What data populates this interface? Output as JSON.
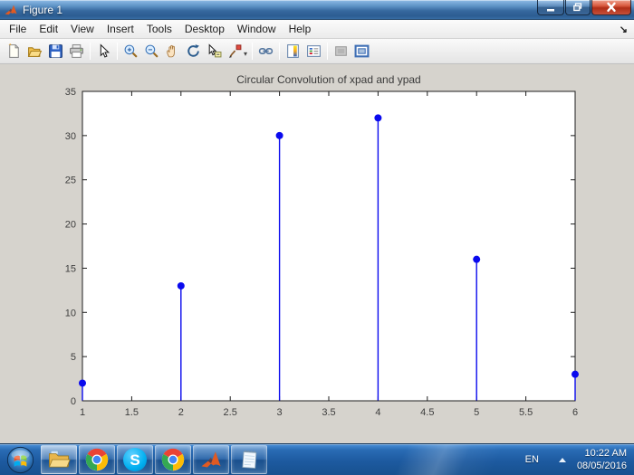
{
  "window": {
    "title": "Figure 1"
  },
  "icons": {
    "dock_arrow": "↘",
    "brush_caret": "▾"
  },
  "menu": {
    "items": [
      "File",
      "Edit",
      "View",
      "Insert",
      "Tools",
      "Desktop",
      "Window",
      "Help"
    ]
  },
  "toolbar": {
    "icons": [
      "new-figure",
      "open-file",
      "save-figure",
      "print-figure",
      "edit-plot",
      "zoom-in",
      "zoom-out",
      "pan",
      "rotate-3d",
      "data-cursor",
      "brush-data",
      "link-plot",
      "insert-colorbar",
      "insert-legend",
      "hide-plot-tools",
      "show-plot-tools-dock"
    ]
  },
  "chart_data": {
    "type": "stem",
    "title": "Circular Convolution of xpad and ypad",
    "x": [
      1,
      2,
      3,
      4,
      5,
      6
    ],
    "y": [
      2,
      13,
      30,
      32,
      16,
      3
    ],
    "xlabel": "",
    "ylabel": "",
    "xlim": [
      1,
      6
    ],
    "ylim": [
      0,
      35
    ],
    "xticks": [
      1,
      1.5,
      2,
      2.5,
      3,
      3.5,
      4,
      4.5,
      5,
      5.5,
      6
    ],
    "yticks": [
      0,
      5,
      10,
      15,
      20,
      25,
      30,
      35
    ],
    "grid": false,
    "legend": null,
    "box": true,
    "stem_color": "#0a0aee",
    "marker": "filled-circle",
    "background": "#ffffff"
  },
  "taskbar": {
    "items": [
      {
        "name": "start"
      },
      {
        "name": "windows-explorer"
      },
      {
        "name": "chrome"
      },
      {
        "name": "skype",
        "glyph": "S"
      },
      {
        "name": "chrome-2"
      },
      {
        "name": "matlab"
      },
      {
        "name": "notepad"
      }
    ],
    "tray": {
      "language": "EN",
      "time": "10:22 AM",
      "date": "08/05/2016"
    }
  },
  "colors": {
    "stem": "#0a0aee",
    "titlebar": "#36689e",
    "taskbar": "#1d5aa0",
    "canvas": "#d6d3cd",
    "close_button": "#b02e17"
  }
}
